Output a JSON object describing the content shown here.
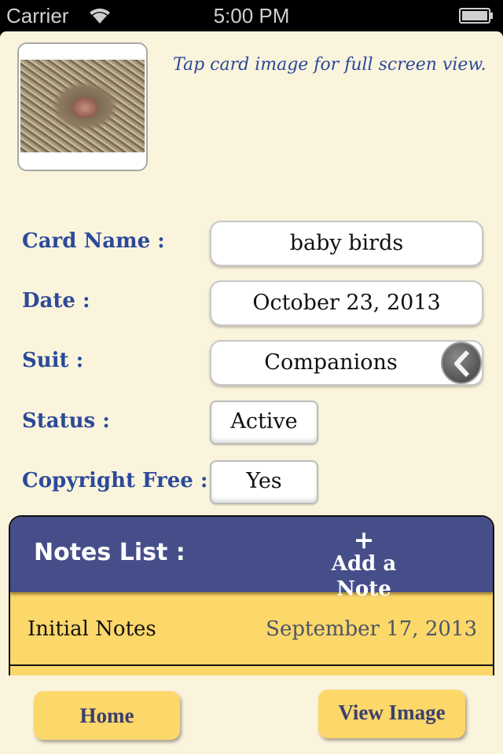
{
  "status_bar": {
    "carrier": "Carrier",
    "time": "5:00 PM",
    "wifi_icon": "wifi-icon",
    "battery_icon": "battery-icon"
  },
  "card": {
    "image_alt": "baby birds in nest",
    "hint": "Tap card image for full screen view."
  },
  "fields": {
    "card_name": {
      "label": "Card Name :",
      "value": "baby birds"
    },
    "date": {
      "label": "Date :",
      "value": "October 23, 2013"
    },
    "suit": {
      "label": "Suit :",
      "value": "Companions",
      "icon": "chevron-left-icon"
    },
    "status": {
      "label": "Status :",
      "value": "Active"
    },
    "copyright": {
      "label": "Copyright Free :",
      "value": "Yes"
    }
  },
  "notes": {
    "title": "Notes List :",
    "add_plus": "+",
    "add_label": "Add a Note",
    "items": [
      {
        "name": "Initial Notes",
        "date": "September 17, 2013"
      }
    ]
  },
  "buttons": {
    "home": "Home",
    "view_image": "View Image"
  },
  "colors": {
    "label_blue": "#2c4a9a",
    "header_navy": "#464e8a",
    "gold": "#fcd769",
    "paper": "#fbf4dd"
  }
}
